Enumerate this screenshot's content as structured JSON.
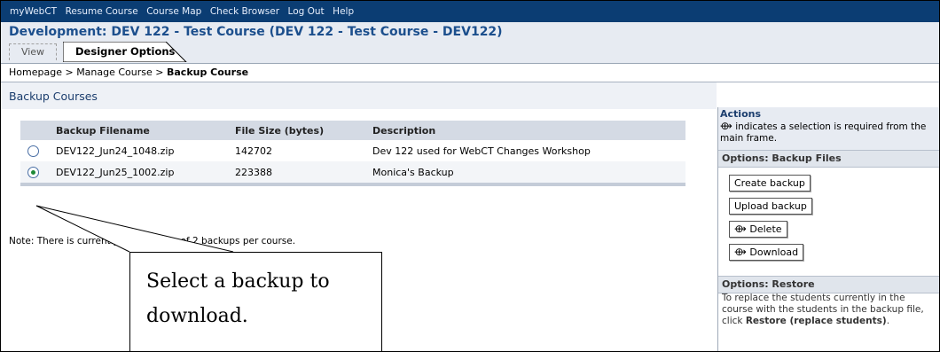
{
  "nav": {
    "items": [
      "myWebCT",
      "Resume Course",
      "Course Map",
      "Check Browser",
      "Log Out",
      "Help"
    ]
  },
  "course": {
    "title": "Development: DEV 122 - Test Course  (DEV 122 - Test Course - DEV122)",
    "tab_view": "View",
    "tab_designer": "Designer Options"
  },
  "breadcrumb": {
    "home": "Homepage",
    "sep": " > ",
    "manage": "Manage Course",
    "current": "Backup Course"
  },
  "main": {
    "title": "Backup Courses",
    "columns": [
      "Backup Filename",
      "File Size (bytes)",
      "Description"
    ],
    "rows": [
      {
        "filename": "DEV122_Jun24_1048.zip",
        "size": "142702",
        "description": "Dev 122 used for WebCT Changes Workshop",
        "selected": false
      },
      {
        "filename": "DEV122_Jun25_1002.zip",
        "size": "223388",
        "description": "Monica's Backup",
        "selected": true
      }
    ],
    "note": "Note: There is currently a restriction of 2 backups per course."
  },
  "callout": {
    "line1": "Select a backup to",
    "line2": "download."
  },
  "sidebar": {
    "actions_title": "Actions",
    "actions_desc": "indicates a selection is required from the main frame.",
    "backup_head": "Options: Backup Files",
    "create": "Create backup",
    "upload": "Upload backup",
    "delete": "Delete",
    "download": "Download",
    "restore_head": "Options: Restore",
    "restore_text_pre": "To replace the students currently in the course with the students in the backup file, click ",
    "restore_text_bold": "Restore (replace students)",
    "restore_text_post": "."
  },
  "colors": {
    "nav_bg": "#0b3d73",
    "title_blue": "#1c4f8d",
    "selected_radio": "#1f8a37"
  }
}
